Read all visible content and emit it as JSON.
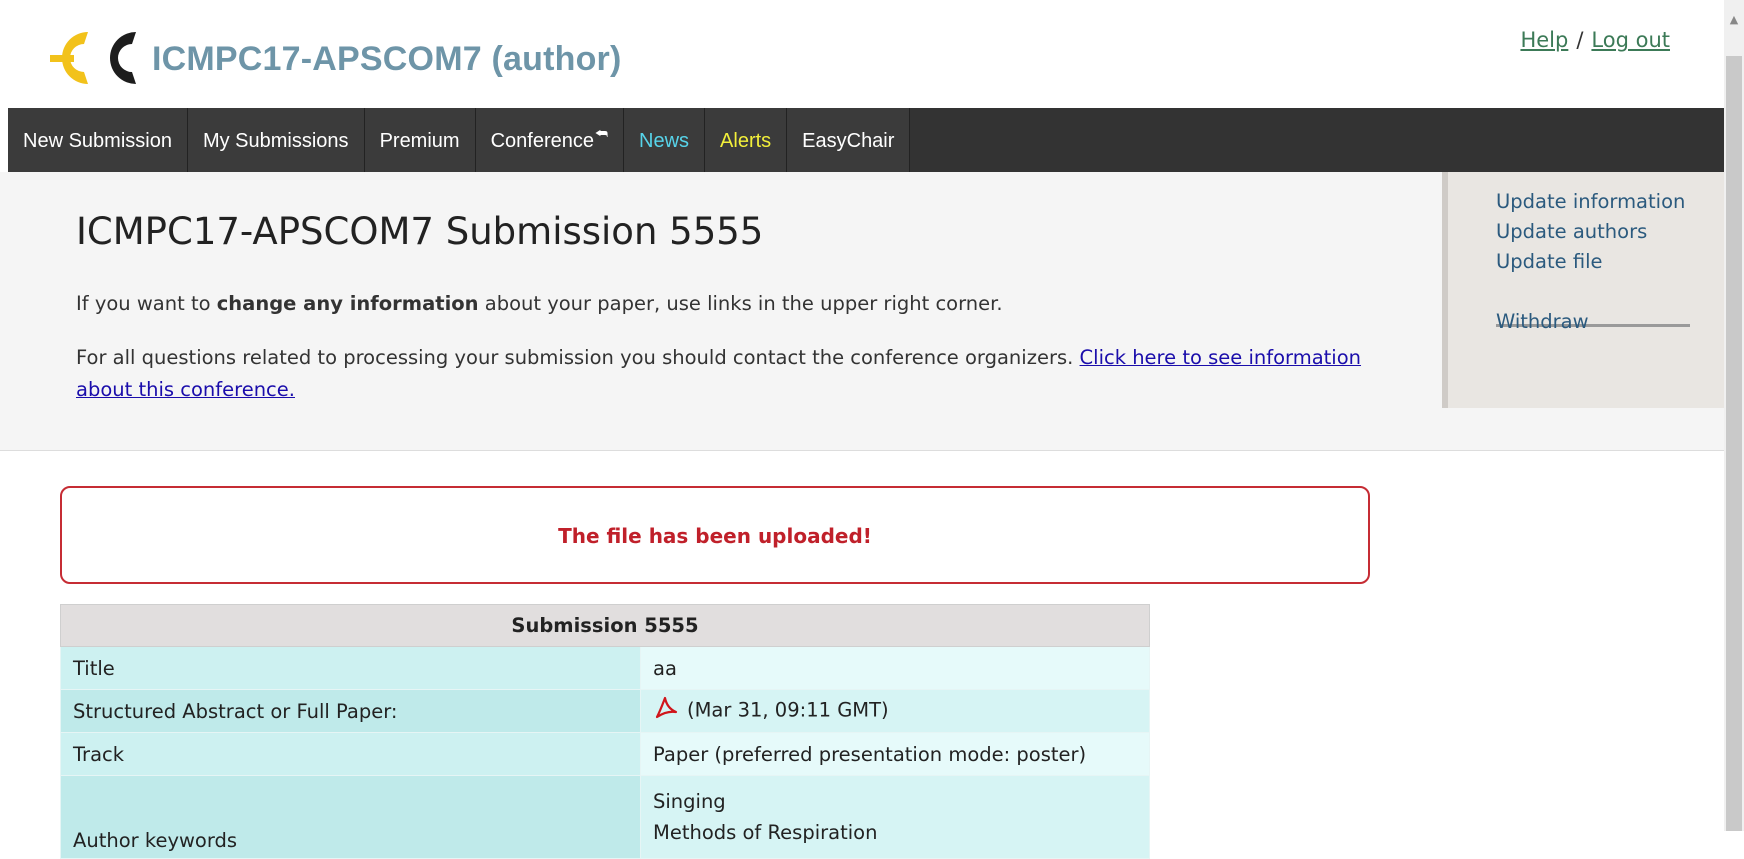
{
  "header": {
    "logo_text": "EC",
    "app_title": "ICMPC17-APSCOM7 (author)",
    "help_link": "Help",
    "separator": "/",
    "logout_link": "Log out"
  },
  "menu": [
    {
      "label": "New Submission"
    },
    {
      "label": "My Submissions"
    },
    {
      "label": "Premium"
    },
    {
      "label": "Conference"
    },
    {
      "label": "News"
    },
    {
      "label": "Alerts"
    },
    {
      "label": "EasyChair"
    }
  ],
  "page": {
    "title": "ICMPC17-APSCOM7 Submission 5555",
    "intro_before": "If you want to ",
    "intro_bold": "change any information",
    "intro_after": " about your paper, use links in the upper right corner.",
    "contact_text": "For all questions related to processing your submission you should contact the conference organizers. ",
    "contact_link": "Click here to see information about this conference."
  },
  "side_links": {
    "update_information": "Update information",
    "update_authors": "Update authors",
    "update_file": "Update file",
    "withdraw": "Withdraw"
  },
  "alert": {
    "message": "The file has been uploaded!"
  },
  "submission_table": {
    "header": "Submission 5555",
    "rows": [
      {
        "label": "Title",
        "value": "aa"
      },
      {
        "label": "Structured Abstract or Full Paper:",
        "value": "(Mar 31, 09:11 GMT)",
        "icon": "pdf-icon"
      },
      {
        "label": "Track",
        "value": "Paper (preferred presentation mode: poster)"
      },
      {
        "label": "Author keywords",
        "keywords": [
          "Singing",
          "Methods of Respiration"
        ]
      }
    ]
  },
  "colors": {
    "title_blue": "#6e95a8",
    "menu_bg": "#333333",
    "news": "#57d4ea",
    "alerts": "#f2ef3a",
    "alert_red": "#c0202a",
    "table_cyan": "#cdf1f1"
  }
}
